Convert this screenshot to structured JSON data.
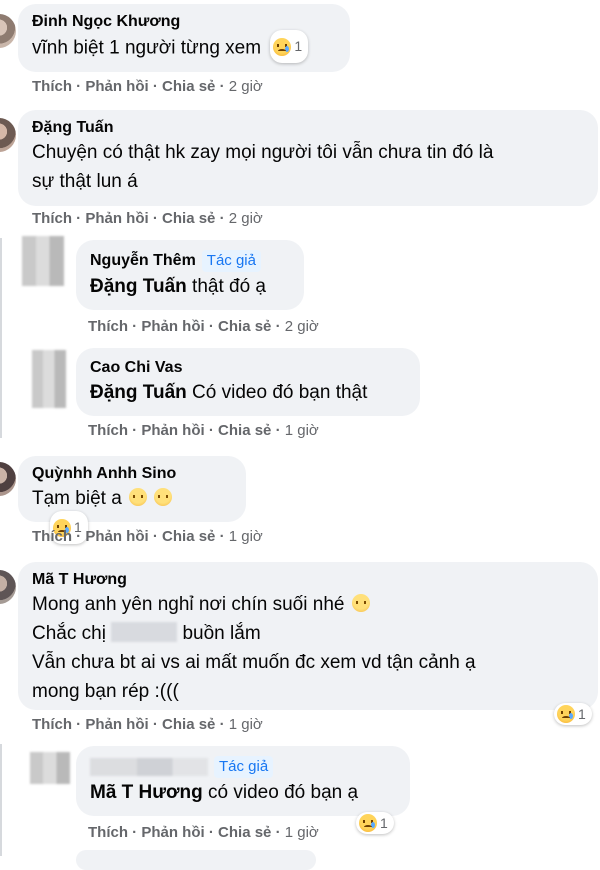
{
  "actions": {
    "like": "Thích",
    "reply": "Phản hồi",
    "share": "Chia sẻ",
    "sep": "·"
  },
  "author_badge": "Tác giả",
  "comments": [
    {
      "name": "Đinh Ngọc Khương",
      "text": "vĩnh biệt 1 người từng xem",
      "time": "2 giờ",
      "reactions": "1"
    },
    {
      "name": "Đặng Tuấn",
      "text_line1": "Chuyện có thật hk zay mọi người tôi vẫn chưa tin đó là",
      "text_line2": "sự thật lun á",
      "time": "2 giờ"
    },
    {
      "name": "Nguyễn Thêm",
      "mention": "Đặng Tuấn",
      "text": "thật đó ạ",
      "time": "2 giờ"
    },
    {
      "name": "Cao Chi Vas",
      "mention": "Đặng Tuấn",
      "text": "Có video đó bạn thật",
      "time": "1 giờ"
    },
    {
      "name": "Quỳnhh Anhh Sino",
      "text": "Tạm biệt a",
      "time": "1 giờ",
      "reactions": "1"
    },
    {
      "name": "Mã T Hương",
      "line1": "Mong anh yên nghỉ nơi chín suối nhé",
      "line2_a": "Chắc chị",
      "line2_b": "buồn lắm",
      "line3": "Vẫn chưa bt ai vs ai mất muốn đc xem vd tận cảnh ạ",
      "line4": "mong bạn rép :(((",
      "time": "1 giờ",
      "reactions": "1"
    },
    {
      "mention": "Mã T Hương",
      "text": "có video đó bạn ạ",
      "time": "1 giờ",
      "reactions": "1"
    }
  ]
}
